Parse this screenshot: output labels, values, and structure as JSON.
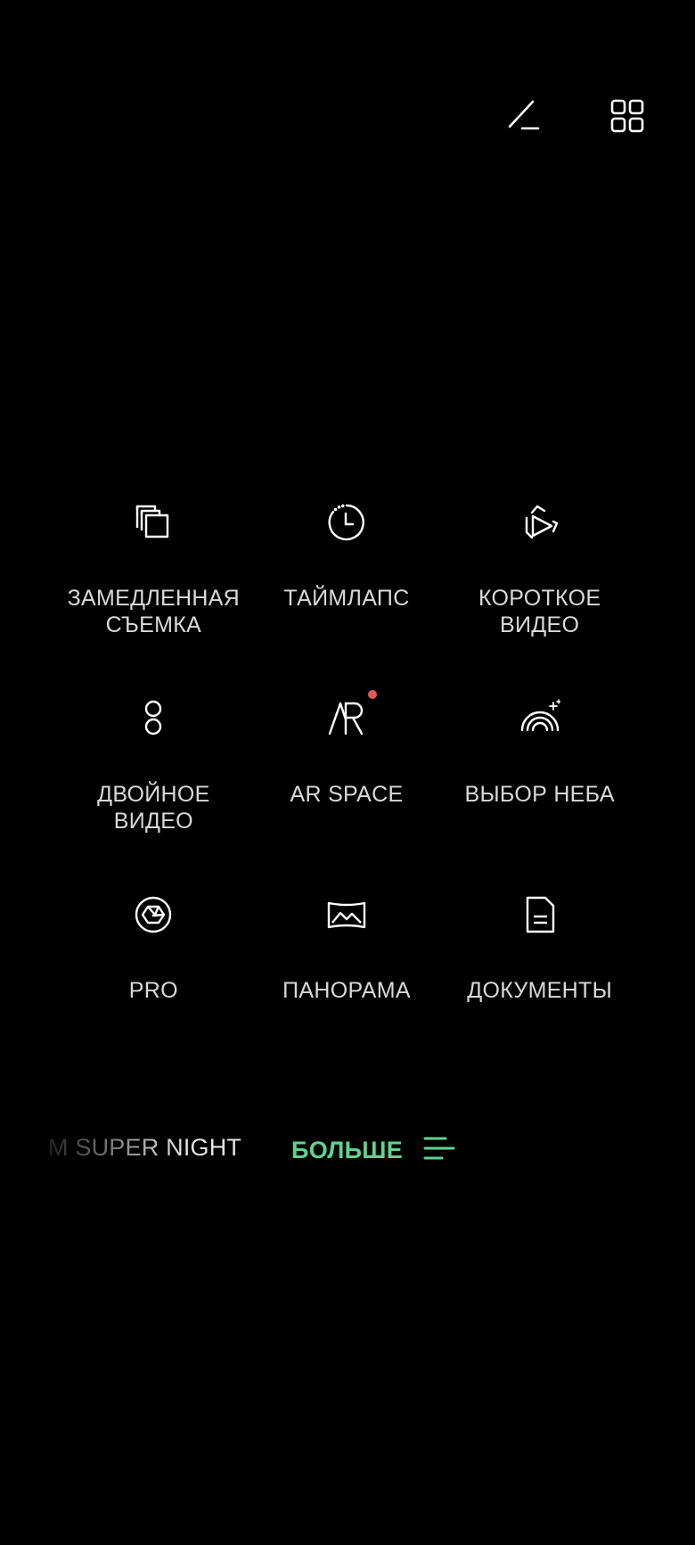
{
  "top_bar": {
    "edit_icon": "edit-pencil-icon",
    "grid_icon": "grid-icon"
  },
  "modes": [
    {
      "label": "ЗАМЕДЛЕННАЯ\nСЪЕМКА",
      "icon": "slow-motion-icon"
    },
    {
      "label": "ТАЙМЛАПС",
      "icon": "timelapse-icon"
    },
    {
      "label": "КОРОТКОЕ\nВИДЕО",
      "icon": "short-video-icon"
    },
    {
      "label": "ДВОЙНОЕ\nВИДЕО",
      "icon": "dual-video-icon"
    },
    {
      "label": "AR SPACE",
      "icon": "ar-icon",
      "badge": "new-dot"
    },
    {
      "label": "ВЫБОР НЕБА",
      "icon": "sky-rainbow-icon"
    },
    {
      "label": "PRO",
      "icon": "pro-aperture-icon"
    },
    {
      "label": "ПАНОРАМА",
      "icon": "panorama-icon"
    },
    {
      "label": "ДОКУМЕНТЫ",
      "icon": "document-icon"
    }
  ],
  "bottom_bar": {
    "previous_mode": "M SUPER NIGHT",
    "current_mode": "БОЛЬШЕ",
    "menu_icon": "menu-lines-icon"
  },
  "colors": {
    "background": "#000000",
    "text": "#d9d9d9",
    "accent": "#5fd38d",
    "badge": "#e05a5a"
  }
}
